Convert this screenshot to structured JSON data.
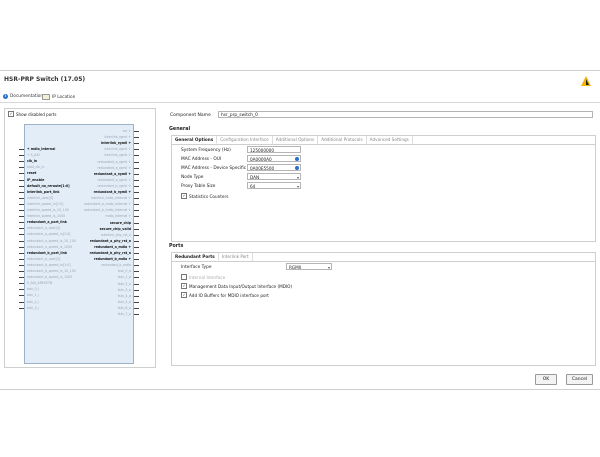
{
  "window": {
    "title": "HSR-PRP Switch (17.05)"
  },
  "toolbar": {
    "documentation": "Documentation",
    "ip_location": "IP Location"
  },
  "left": {
    "show_disabled": "Show disabled ports",
    "left_pins": [
      {
        "t": "+ mdio_internal",
        "s": "b"
      },
      {
        "t": "+ S_AXI",
        "s": "d"
      },
      {
        "t": "clk_in",
        "s": "b"
      },
      {
        "t": "host_clk_in",
        "s": "d"
      },
      {
        "t": "reset",
        "s": "b"
      },
      {
        "t": "IP_enable",
        "s": "b"
      },
      {
        "t": "default_no_reroute[1:0]",
        "s": "b"
      },
      {
        "t": "interlink_port_link",
        "s": "b"
      },
      {
        "t": "interlink_user[0]",
        "s": "d"
      },
      {
        "t": "interlink_speed_in[1:0]",
        "s": "d"
      },
      {
        "t": "interlink_speed_is_10_100",
        "s": "d"
      },
      {
        "t": "interlink_speed_is_1000",
        "s": "d"
      },
      {
        "t": "redundant_a_port_link",
        "s": "b"
      },
      {
        "t": "redundant_a_user[0]",
        "s": "d"
      },
      {
        "t": "redundant_a_speed_in[1:0]",
        "s": "d"
      },
      {
        "t": "redundant_a_speed_is_10_100",
        "s": "d"
      },
      {
        "t": "redundant_a_speed_is_1000",
        "s": "d"
      },
      {
        "t": "redundant_b_port_link",
        "s": "b"
      },
      {
        "t": "redundant_b_user[0]",
        "s": "d"
      },
      {
        "t": "redundant_b_speed_in[1:0]",
        "s": "d"
      },
      {
        "t": "redundant_b_speed_is_10_100",
        "s": "d"
      },
      {
        "t": "redundant_b_speed_is_1000",
        "s": "d"
      },
      {
        "t": "S_AXI_ARESETN",
        "s": "d"
      },
      {
        "t": "tstv_0_i",
        "s": "d"
      },
      {
        "t": "tstv_1_i",
        "s": "d"
      },
      {
        "t": "tstv_2_i",
        "s": "d"
      },
      {
        "t": "tstv_3_i",
        "s": "d"
      }
    ],
    "right_pins": [
      {
        "t": "csr +",
        "s": "d"
      },
      {
        "t": "interlink_rgmii +",
        "s": "d"
      },
      {
        "t": "interlink_rgmii +",
        "s": "b"
      },
      {
        "t": "interlink_rgmii +",
        "s": "d"
      },
      {
        "t": "interlink_rgmii +",
        "s": "d"
      },
      {
        "t": "redundant_a_rgmii +",
        "s": "d"
      },
      {
        "t": "redundant_a_rgmii +",
        "s": "d"
      },
      {
        "t": "redundant_a_rgmii +",
        "s": "b"
      },
      {
        "t": "redundant_a_rgmii +",
        "s": "d"
      },
      {
        "t": "redundant_b_rgmii +",
        "s": "d"
      },
      {
        "t": "redundant_b_rgmii +",
        "s": "b"
      },
      {
        "t": "interlink_mdio_internal +",
        "s": "d"
      },
      {
        "t": "redundant_a_mdio_internal +",
        "s": "d"
      },
      {
        "t": "redundant_b_mdio_internal +",
        "s": "d"
      },
      {
        "t": "mdio_internal +",
        "s": "d"
      },
      {
        "t": "secure_chip",
        "s": "b"
      },
      {
        "t": "secure_chip_valid",
        "s": "b"
      },
      {
        "t": "interlink_phy_rst_n",
        "s": "d"
      },
      {
        "t": "redundant_a_phy_rst_n",
        "s": "b"
      },
      {
        "t": "redundant_a_mdio +",
        "s": "b"
      },
      {
        "t": "redundant_b_phy_rst_n",
        "s": "b"
      },
      {
        "t": "redundant_b_mdio +",
        "s": "b"
      },
      {
        "t": "redundant_b_mdio",
        "s": "d"
      },
      {
        "t": "tstv_0_o",
        "s": "d"
      },
      {
        "t": "tstv_1_o",
        "s": "d"
      },
      {
        "t": "tstv_2_o",
        "s": "d"
      },
      {
        "t": "tstv_3_o",
        "s": "d"
      },
      {
        "t": "tstv_4_o",
        "s": "d"
      },
      {
        "t": "tstv_5_o",
        "s": "d"
      },
      {
        "t": "tstv_6_o",
        "s": "d"
      },
      {
        "t": "tstv_7_o",
        "s": "d"
      }
    ]
  },
  "right": {
    "component_name_label": "Component Name",
    "component_name_value": "hsr_prp_switch_0",
    "general_header": "General",
    "general_tabs": [
      "General Options",
      "Configuration Interface",
      "Additional Options",
      "Additional Protocols",
      "Advanced Settings"
    ],
    "fields": [
      {
        "label": "System Frequency (Hz)",
        "value": "125000000",
        "kind": "text"
      },
      {
        "label": "MAC Address - OUI",
        "value": "0A0000A0",
        "kind": "info"
      },
      {
        "label": "MAC Address - Device Specific",
        "value": "0A00E5500",
        "kind": "info"
      },
      {
        "label": "Node Type",
        "value": "DAN",
        "kind": "dd"
      },
      {
        "label": "Proxy Table Size",
        "value": "64",
        "kind": "dd"
      }
    ],
    "stats_counters": "Statistics Counters",
    "ports_header": "Ports",
    "ports_tabs": [
      "Redundant Ports",
      "Interlink Port"
    ],
    "interface_type_label": "Interface Type",
    "interface_type_value": "RGMII",
    "internal_interface": "Internal Interface",
    "mdio_label": "Management Data Input/Output Interface (MDIO)",
    "io_buffers_label": "Add IO Buffers for MDIO interface port"
  },
  "buttons": {
    "ok": "OK",
    "cancel": "Cancel"
  },
  "colors": {
    "block_fill": "#e3edf8",
    "info_blue": "#2a6fc9",
    "logo_yellow": "#f5b400"
  }
}
